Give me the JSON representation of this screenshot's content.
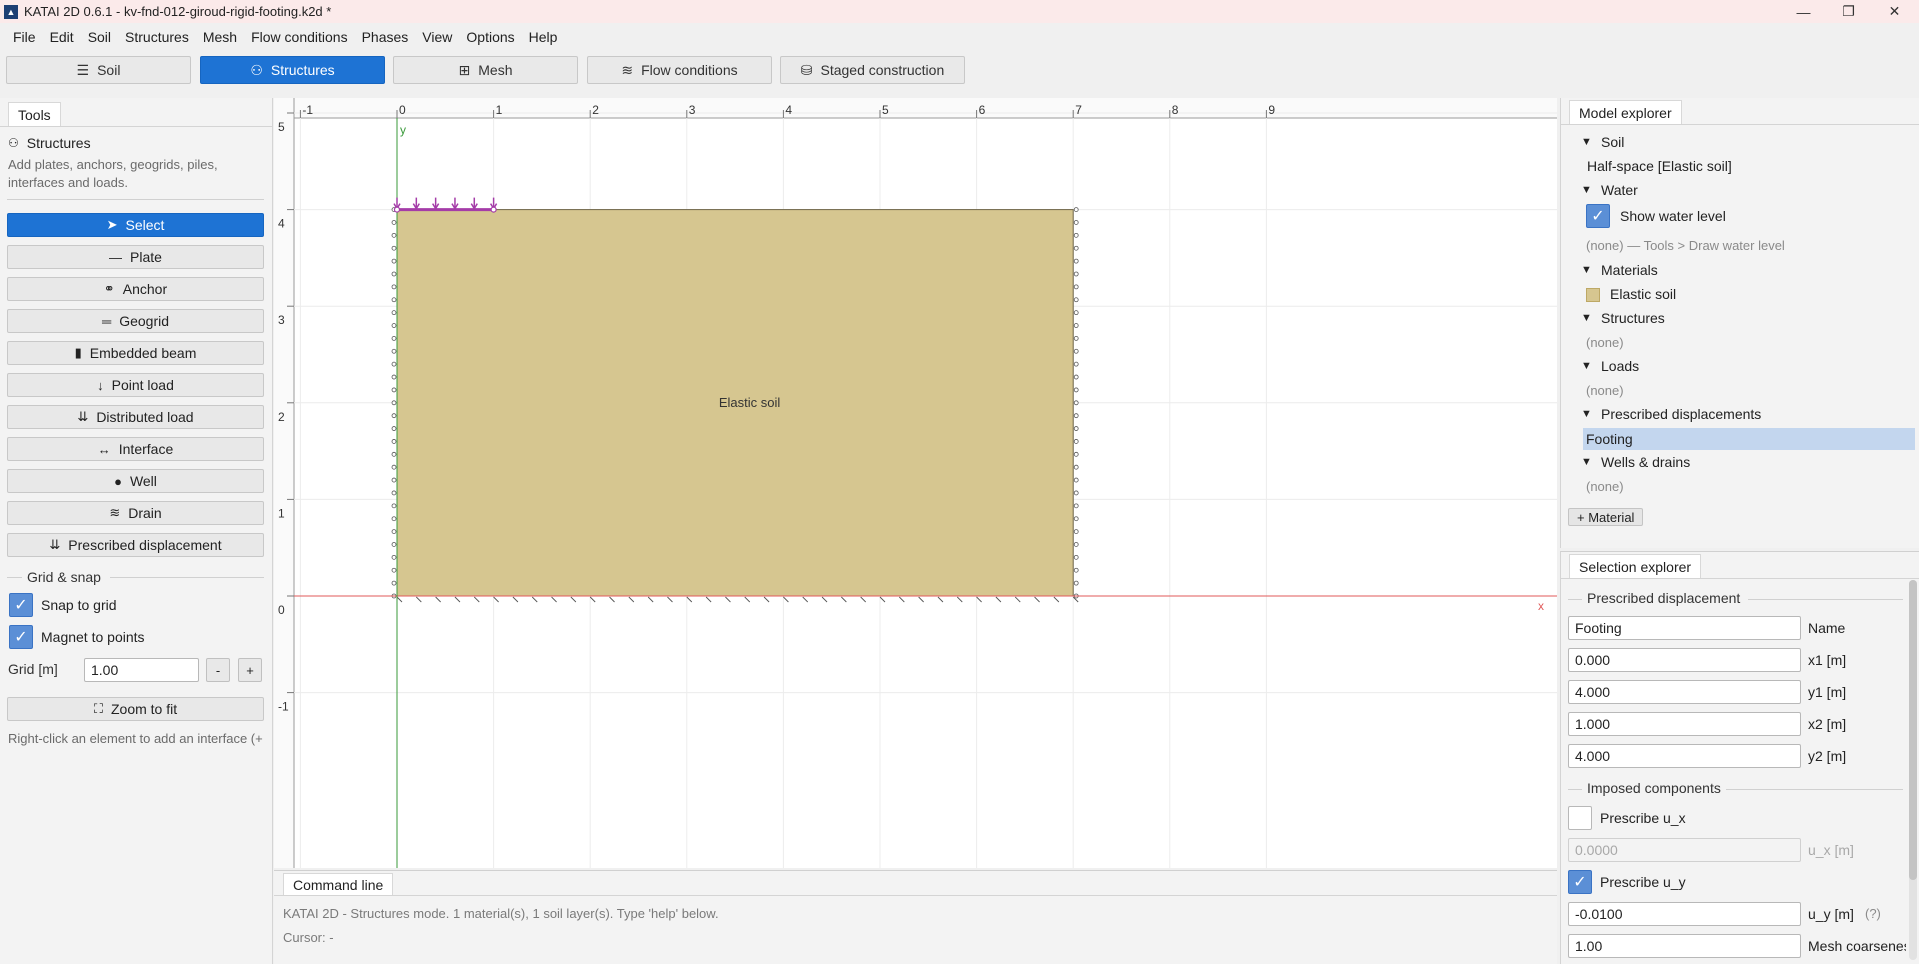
{
  "window": {
    "title": "KATAI 2D 0.6.1 - kv-fnd-012-giroud-rigid-footing.k2d *",
    "app_icon": "katai-logo-icon"
  },
  "menu": [
    "File",
    "Edit",
    "Soil",
    "Structures",
    "Mesh",
    "Flow conditions",
    "Phases",
    "View",
    "Options",
    "Help"
  ],
  "modes": [
    {
      "label": "Soil",
      "icon": "layers-icon",
      "active": false
    },
    {
      "label": "Structures",
      "icon": "structure-icon",
      "active": true
    },
    {
      "label": "Mesh",
      "icon": "grid-icon",
      "active": false
    },
    {
      "label": "Flow conditions",
      "icon": "waves-icon",
      "active": false
    },
    {
      "label": "Staged construction",
      "icon": "stages-icon",
      "active": false
    }
  ],
  "tools": {
    "tab": "Tools",
    "heading": "Structures",
    "description": "Add plates, anchors, geogrids, piles, interfaces and loads.",
    "buttons": [
      "Select",
      "Plate",
      "Anchor",
      "Geogrid",
      "Embedded beam",
      "Point load",
      "Distributed load",
      "Interface",
      "Well",
      "Drain",
      "Prescribed displacement"
    ],
    "grid_section": "Grid & snap",
    "snap_to_grid": "Snap to grid",
    "magnet_to_points": "Magnet to points",
    "grid_label": "Grid [m]",
    "grid_value": "1.00",
    "minus": "-",
    "plus": "+",
    "zoom_to_fit": "Zoom to fit",
    "hint": "Right-click an element to add an interface (+"
  },
  "canvas": {
    "x_ticks": [
      "-1",
      "0",
      "1",
      "2",
      "3",
      "4",
      "5",
      "6",
      "7",
      "8",
      "9"
    ],
    "y_ticks": [
      "5",
      "4",
      "3",
      "2",
      "1",
      "0",
      "-1"
    ],
    "axis_x_label": "x",
    "axis_y_label": "y",
    "soil_label": "Elastic soil",
    "soil_color": "#d6c690",
    "load_color": "#a43ca8",
    "axis_x_color": "#e05a5a",
    "axis_y_color": "#3a9a3a"
  },
  "command": {
    "tab": "Command line",
    "message": "KATAI 2D - Structures mode.  1 material(s), 1 soil layer(s).  Type 'help' below.",
    "cursor": "Cursor:  -"
  },
  "model_explorer": {
    "tab": "Model explorer",
    "soil": "Soil",
    "half_space": "Half-space  [Elastic soil]",
    "water": "Water",
    "show_water_level": "Show water level",
    "water_none": "(none) — Tools > Draw water level",
    "materials": "Materials",
    "material_item": "Elastic soil",
    "structures": "Structures",
    "structures_none": "(none)",
    "loads": "Loads",
    "loads_none": "(none)",
    "prescribed": "Prescribed displacements",
    "prescribed_item": "Footing",
    "wells": "Wells & drains",
    "wells_none": "(none)",
    "add_material": "+ Material"
  },
  "selection_explorer": {
    "tab": "Selection explorer",
    "group": "Prescribed displacement",
    "name_value": "Footing",
    "name_label": "Name",
    "x1_value": "0.000",
    "x1_label": "x1 [m]",
    "y1_value": "4.000",
    "y1_label": "y1 [m]",
    "x2_value": "1.000",
    "x2_label": "x2 [m]",
    "y2_value": "4.000",
    "y2_label": "y2 [m]",
    "imposed_group": "Imposed components",
    "prescribe_ux": "Prescribe u_x",
    "ux_value": "0.0000",
    "ux_label": "u_x [m]",
    "prescribe_uy": "Prescribe u_y",
    "uy_value": "-0.0100",
    "uy_label": "u_y [m]",
    "uy_help": "(?)",
    "coarseness_value": "1.00",
    "coarseness_label": "Mesh coarseness"
  }
}
